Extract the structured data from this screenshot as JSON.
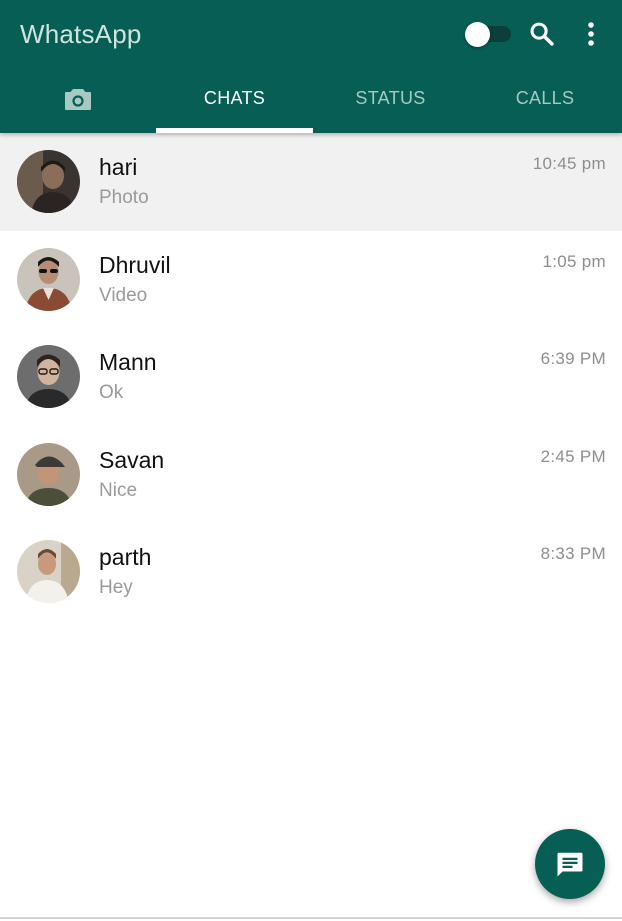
{
  "app": {
    "title": "WhatsApp",
    "theme_color": "#075e54",
    "dark_mode_toggle": {
      "on": false
    }
  },
  "header_icons": {
    "search": "search-icon",
    "more": "more-vertical-icon"
  },
  "tabs": [
    {
      "id": "camera",
      "label": "",
      "icon": "camera-icon",
      "active": false
    },
    {
      "id": "chats",
      "label": "CHATS",
      "active": true
    },
    {
      "id": "status",
      "label": "STATUS",
      "active": false
    },
    {
      "id": "calls",
      "label": "CALLS",
      "active": false
    }
  ],
  "chats": [
    {
      "name": "hari",
      "message": "Photo",
      "time": "10:45 pm",
      "selected": true,
      "avatar_colors": [
        "#3a3430",
        "#8a6e5a"
      ]
    },
    {
      "name": "Dhruvil",
      "message": "Video",
      "time": "1:05 pm",
      "selected": false,
      "avatar_colors": [
        "#c9c3bb",
        "#8b4a33"
      ]
    },
    {
      "name": "Mann",
      "message": "Ok",
      "time": "6:39 PM",
      "selected": false,
      "avatar_colors": [
        "#6d6d6d",
        "#2a2a2a"
      ]
    },
    {
      "name": "Savan",
      "message": "Nice",
      "time": "2:45 PM",
      "selected": false,
      "avatar_colors": [
        "#a89a86",
        "#4a4f3a"
      ]
    },
    {
      "name": "parth",
      "message": "Hey",
      "time": "8:33 PM",
      "selected": false,
      "avatar_colors": [
        "#d8d3c6",
        "#6b4a34"
      ]
    }
  ],
  "fab": {
    "icon": "new-chat-icon"
  }
}
